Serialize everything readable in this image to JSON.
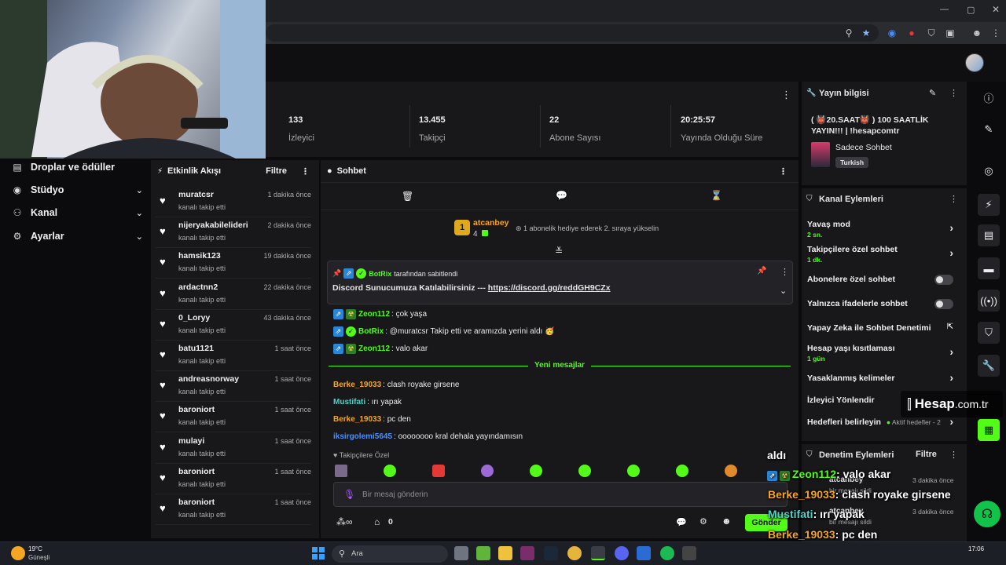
{
  "app": {
    "nav": [
      {
        "label": "Droplar ve ödüller",
        "icon": "gift-icon",
        "chevron": false
      },
      {
        "label": "Stüdyo",
        "icon": "camera-icon",
        "chevron": true
      },
      {
        "label": "Kanal",
        "icon": "users-icon",
        "chevron": true
      },
      {
        "label": "Ayarlar",
        "icon": "gear-icon",
        "chevron": true
      }
    ]
  },
  "stats": [
    {
      "value": "133",
      "label": "İzleyici"
    },
    {
      "value": "13.455",
      "label": "Takipçi"
    },
    {
      "value": "22",
      "label": "Abone Sayısı"
    },
    {
      "value": "20:25:57",
      "label": "Yayında Olduğu Süre"
    }
  ],
  "activity": {
    "title": "Etkinlik Akışı",
    "filter_label": "Filtre",
    "items": [
      {
        "user": "muratcsr",
        "action": "kanalı takip etti",
        "time": "1 dakika önce"
      },
      {
        "user": "nijeryakabilelideri",
        "action": "kanalı takip etti",
        "time": "2 dakika önce"
      },
      {
        "user": "hamsik123",
        "action": "kanalı takip etti",
        "time": "19 dakika önce"
      },
      {
        "user": "ardactnn2",
        "action": "kanalı takip etti",
        "time": "22 dakika önce"
      },
      {
        "user": "0_Loryy",
        "action": "kanalı takip etti",
        "time": "43 dakika önce"
      },
      {
        "user": "batu1121",
        "action": "kanalı takip etti",
        "time": "1 saat önce"
      },
      {
        "user": "andreasnorway",
        "action": "kanalı takip etti",
        "time": "1 saat önce"
      },
      {
        "user": "baroniort",
        "action": "kanalı takip etti",
        "time": "1 saat önce"
      },
      {
        "user": "mulayi",
        "action": "kanalı takip etti",
        "time": "1 saat önce"
      },
      {
        "user": "baroniort",
        "action": "kanalı takip etti",
        "time": "1 saat önce"
      },
      {
        "user": "baroniort",
        "action": "kanalı takip etti",
        "time": "1 saat önce"
      }
    ]
  },
  "chat": {
    "title": "Sohbet",
    "gift": {
      "user": "atcanbey",
      "count": "4",
      "rank": "1",
      "text": "1 abonelik hediye ederek 2. sıraya yükselin"
    },
    "pinned": {
      "by": "BotRix",
      "by_suffix": "tarafından sabitlendi",
      "text": "Discord Sunucumuza Katılabilirsiniz --- ",
      "link": "https://discord.gg/reddGH9CZx"
    },
    "messages_top": [
      {
        "user": "Zeon112",
        "text": "çok yaşa",
        "color": "#53fc18"
      },
      {
        "user": "BotRix",
        "text": "@muratcsr Takip etti ve aramızda yerini aldı 🥳",
        "color": "#53fc18"
      },
      {
        "user": "Zeon112",
        "text": "valo akar",
        "color": "#53fc18"
      }
    ],
    "new_messages_label": "Yeni mesajlar",
    "messages_bottom": [
      {
        "user": "Berke_19033",
        "text": "clash royake girsene",
        "color": "#f5a623"
      },
      {
        "user": "Mustifati",
        "text": "ırı yapak",
        "color": "#4fd1c5"
      },
      {
        "user": "Berke_19033",
        "text": "pc den",
        "color": "#f5a623"
      },
      {
        "user": "iksirgolemi5645",
        "text": "oooooooo kral dehala yayındamısın",
        "color": "#4a90ff"
      }
    ],
    "followers_only_label": "Takipçilere Özel",
    "input_placeholder": "Bir mesaj gönderin",
    "points_count": "0",
    "send_label": "Gönder"
  },
  "stream_info": {
    "title": "Yayın bilgisi",
    "stream_title": "( 👹20.SAAT👹 ) 100 SAATLİK YAYIN!!! | !hesapcomtr",
    "category": "Sadece Sohbet",
    "language": "Turkish"
  },
  "channel_actions": {
    "title": "Kanal Eylemleri",
    "items": [
      {
        "label": "Yavaş mod",
        "sub": "2 sn.",
        "control": "chevron"
      },
      {
        "label": "Takipçilere özel sohbet",
        "sub": "1 dk.",
        "control": "chevron"
      },
      {
        "label": "Abonelere özel sohbet",
        "sub": "",
        "control": "toggle"
      },
      {
        "label": "Yalnızca ifadelerle sohbet",
        "sub": "",
        "control": "toggle"
      },
      {
        "label": "Yapay Zeka ile Sohbet Denetimi",
        "sub": "",
        "control": "external"
      },
      {
        "label": "Hesap yaşı kısıtlaması",
        "sub": "1 gün",
        "control": "chevron"
      },
      {
        "label": "Yasaklanmış kelimeler",
        "sub": "",
        "control": "chevron"
      },
      {
        "label": "İzleyici Yönlendir",
        "sub": "",
        "control": "none"
      },
      {
        "label": "Hedefleri belirleyin",
        "sub": "",
        "control": "chevron"
      }
    ],
    "goals_status": "Aktif hedefler - 2"
  },
  "mod_actions": {
    "title": "Denetim Eylemleri",
    "filter_label": "Filtre",
    "items": [
      {
        "user": "atcanbey",
        "text": "bir mesajı sildi",
        "time": "3 dakika önce"
      },
      {
        "user": "atcanbey",
        "text": "bir mesajı sildi",
        "time": "3 dakika önce"
      }
    ]
  },
  "overlay_chat": [
    {
      "user": "Zeon112",
      "text": ": valo akar",
      "color": "#53fc18"
    },
    {
      "user": "Berke_19033",
      "text": ": clash royake girsene",
      "color": "#f5a623"
    },
    {
      "user": "Mustifati",
      "text": ": ırı yapak",
      "color": "#4fd1c5"
    },
    {
      "user": "Berke_19033",
      "text": ": pc den",
      "color": "#f5a623"
    },
    {
      "user": "iksirgolemi5645",
      "text": ": oooooooo kral dehala yay",
      "color": "#4a90ff"
    }
  ],
  "overlay_fragment": "aldı",
  "watermark": {
    "brand": "Hesap",
    "tld": ".com.tr"
  },
  "taskbar": {
    "weather_temp": "19°C",
    "weather_desc": "Güneşli",
    "search_placeholder": "Ara",
    "clock_time": "17:06"
  },
  "colors": {
    "accent": "#53fc18",
    "panel": "#18181b",
    "bg": "#0b0b0d"
  }
}
